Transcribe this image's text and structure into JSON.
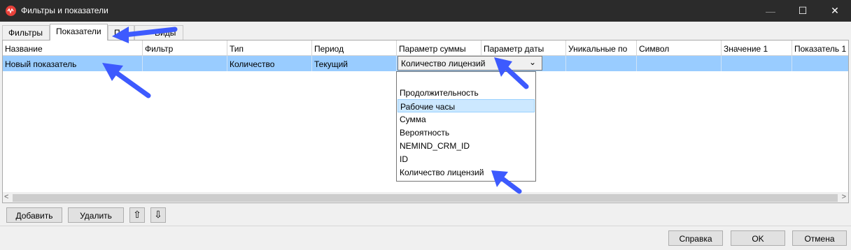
{
  "window": {
    "title": "Фильтры и показатели",
    "minimize_glyph": "—",
    "maximize_glyph": "☐",
    "close_glyph": "✕",
    "accent": "#e8413a"
  },
  "tabs": [
    {
      "label": "Фильтры",
      "active": false
    },
    {
      "label": "Показатели",
      "active": true
    },
    {
      "label": "П",
      "active": false
    },
    {
      "label": "Виды",
      "active": false
    }
  ],
  "table": {
    "columns": [
      "Название",
      "Фильтр",
      "Тип",
      "Период",
      "Параметр суммы",
      "Параметр даты",
      "Уникальные по",
      "Символ",
      "Значение 1",
      "Показатель 1"
    ],
    "rows": [
      {
        "name": "Новый показатель",
        "filter": "",
        "type": "Количество",
        "period": "Текущий",
        "sum_param": "Количество лицензий",
        "date_param": "",
        "unique_by": "",
        "symbol": "",
        "value1": "",
        "indicator1": ""
      }
    ],
    "selected_row_color": "#99ccff"
  },
  "dropdown": {
    "selected": "Количество лицензий",
    "arrow_glyph": "⌄",
    "options": [
      "",
      "Продолжительность",
      "Рабочие часы",
      "Сумма",
      "Вероятность",
      "NEMIND_CRM_ID",
      "ID",
      "Количество лицензий"
    ],
    "highlighted": "Рабочие часы"
  },
  "scrollbar": {
    "left_glyph": "<",
    "right_glyph": ">"
  },
  "actions": {
    "add_label": "Добавить",
    "delete_label": "Удалить",
    "up_glyph": "⇧",
    "down_glyph": "⇩"
  },
  "footer": {
    "help_label": "Справка",
    "ok_label": "OK",
    "cancel_label": "Отмена"
  },
  "annotation_color": "#3d5afe"
}
